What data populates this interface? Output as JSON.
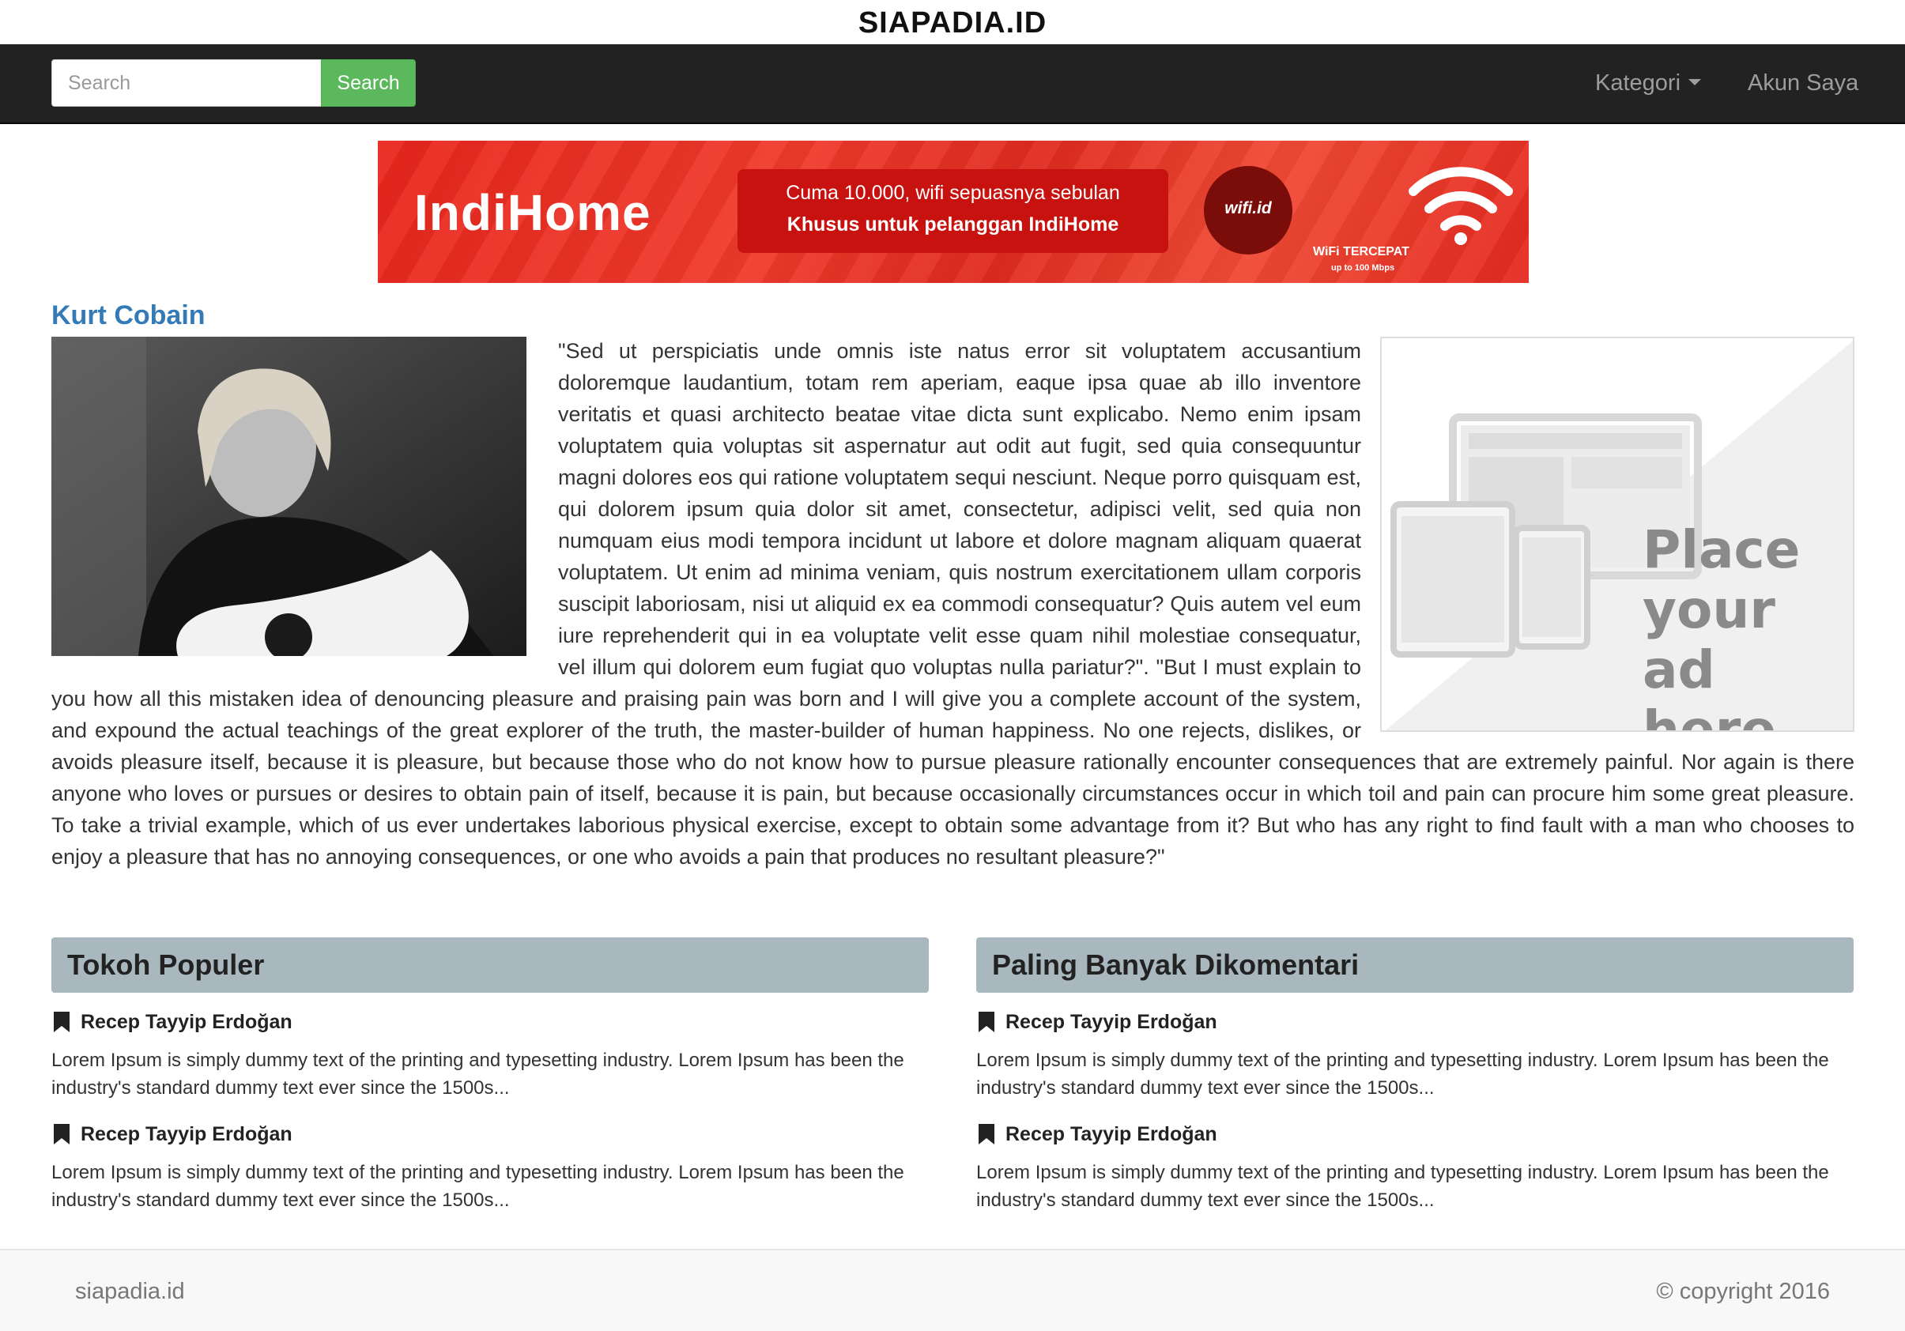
{
  "site": {
    "title": "SIAPADIA.ID"
  },
  "navbar": {
    "search_placeholder": "Search",
    "search_button": "Search",
    "kategori": "Kategori",
    "akun": "Akun Saya"
  },
  "banner": {
    "logo": "IndiHome",
    "line1": "Cuma 10.000, wifi sepuasnya sebulan",
    "line2": "Khusus untuk pelanggan IndiHome",
    "wifi_logo": "wifi.id",
    "tercepat": "WiFi TERCEPAT",
    "speed": "up to 100 Mbps"
  },
  "article": {
    "title": "Kurt Cobain",
    "body": "\"Sed ut perspiciatis unde omnis iste natus error sit voluptatem accusantium doloremque laudantium, totam rem aperiam, eaque ipsa quae ab illo inventore veritatis et quasi architecto beatae vitae dicta sunt explicabo. Nemo enim ipsam voluptatem quia voluptas sit aspernatur aut odit aut fugit, sed quia consequuntur magni dolores eos qui ratione voluptatem sequi nesciunt. Neque porro quisquam est, qui dolorem ipsum quia dolor sit amet, consectetur, adipisci velit, sed quia non numquam eius modi tempora incidunt ut labore et dolore magnam aliquam quaerat voluptatem. Ut enim ad minima veniam, quis nostrum exercitationem ullam corporis suscipit laboriosam, nisi ut aliquid ex ea commodi consequatur? Quis autem vel eum iure reprehenderit qui in ea voluptate velit esse quam nihil molestiae consequatur, vel illum qui dolorem eum fugiat quo voluptas nulla pariatur?\". \"But I must explain to you how all this mistaken idea of denouncing pleasure and praising pain was born and I will give you a complete account of the system, and expound the actual teachings of the great explorer of the truth, the master-builder of human happiness. No one rejects, dislikes, or avoids pleasure itself, because it is pleasure, but because those who do not know how to pursue pleasure rationally encounter consequences that are extremely painful. Nor again is there anyone who loves or pursues or desires to obtain pain of itself, because it is pain, but because occasionally circumstances occur in which toil and pain can procure him some great pleasure. To take a trivial example, which of us ever undertakes laborious physical exercise, except to obtain some advantage from it? But who has any right to find fault with a man who chooses to enjoy a pleasure that has no annoying consequences, or one who avoids a pain that produces no resultant pleasure?\""
  },
  "ad": {
    "line1": "Place",
    "line2": "your",
    "line3": "ad here"
  },
  "popular": {
    "heading": "Tokoh Populer",
    "items": [
      {
        "name": "Recep Tayyip Erdoğan",
        "desc": "Lorem Ipsum is simply dummy text of the printing and typesetting industry. Lorem Ipsum has been the industry's standard dummy text ever since the 1500s..."
      },
      {
        "name": "Recep Tayyip Erdoğan",
        "desc": "Lorem Ipsum is simply dummy text of the printing and typesetting industry. Lorem Ipsum has been the industry's standard dummy text ever since the 1500s..."
      }
    ]
  },
  "commented": {
    "heading": "Paling Banyak Dikomentari",
    "items": [
      {
        "name": "Recep Tayyip Erdoğan",
        "desc": "Lorem Ipsum is simply dummy text of the printing and typesetting industry. Lorem Ipsum has been the industry's standard dummy text ever since the 1500s..."
      },
      {
        "name": "Recep Tayyip Erdoğan",
        "desc": "Lorem Ipsum is simply dummy text of the printing and typesetting industry. Lorem Ipsum has been the industry's standard dummy text ever since the 1500s..."
      }
    ]
  },
  "footer": {
    "left": "siapadia.id",
    "right": "© copyright 2016"
  },
  "colors": {
    "navbar": "#222222",
    "search_button": "#5cb85c",
    "link": "#337ab7",
    "panel_heading": "#a9b8bf",
    "banner": "#e8261d"
  },
  "icons": {
    "bookmark": "bookmark-icon",
    "caret": "chevron-down-icon",
    "wifi": "wifi-icon"
  }
}
